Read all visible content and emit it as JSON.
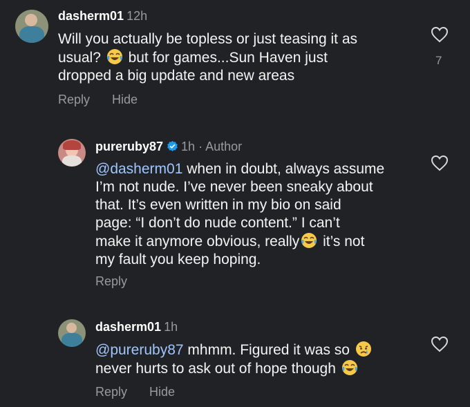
{
  "comments": [
    {
      "username": "dasherm01",
      "time": "12h",
      "text_1": "Will you actually be topless or just teasing it as",
      "text_2a": "usual?",
      "text_2b": "but for games...Sun Haven just",
      "text_3": "dropped a big update and new areas",
      "likes": "7",
      "reply_label": "Reply",
      "hide_label": "Hide"
    },
    {
      "username": "pureruby87",
      "time": "1h",
      "author_label": "· Author",
      "mention": "@dasherm01",
      "text_1": " when in doubt, always assume",
      "text_2": "I’m not nude. I’ve never been sneaky about",
      "text_3": "that. It’s even written in my bio on said",
      "text_4": "page: “I don’t do nude content.” I can’t",
      "text_5a": "make it anymore obvious, really",
      "text_5b": " it’s not",
      "text_6": "my fault you keep hoping.",
      "reply_label": "Reply"
    },
    {
      "username": "dasherm01",
      "time": "1h",
      "mention": "@pureruby87",
      "text_1": " mhmm. Figured it was so",
      "text_2": "never hurts to ask out of hope though",
      "reply_label": "Reply",
      "hide_label": "Hide"
    }
  ],
  "icons": {
    "heart": "heart-icon",
    "verified": "verified-badge-icon",
    "laugh": "tears-of-joy-emoji",
    "sad": "crying-face-emoji"
  },
  "colors": {
    "background": "#202225",
    "mention": "#9fc6ff",
    "muted": "#9a9a9a",
    "verified": "#1d9bf0"
  }
}
